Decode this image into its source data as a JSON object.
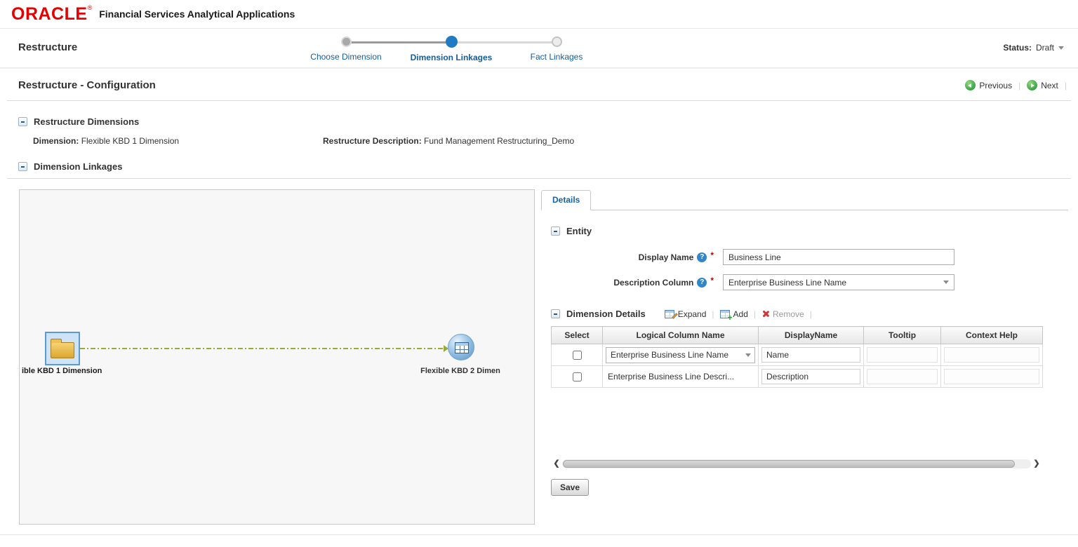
{
  "colors": {
    "brand_red": "#e60000",
    "link_blue": "#155c9c",
    "tab_blue": "#1464a5",
    "step_active_blue": "#1e7bc4",
    "action_green": "#2f9f3f",
    "required_red": "#c00000",
    "connector_olive": "#9aa93c"
  },
  "top_bar": {
    "brand": "ORACLE",
    "brand_mark": "®",
    "app_title": "Financial Services Analytical Applications"
  },
  "workflow_bar": {
    "title": "Restructure",
    "status_label": "Status:",
    "status_value": "Draft",
    "steps": [
      {
        "label": "Choose Dimension",
        "state": "completed"
      },
      {
        "label": "Dimension Linkages",
        "state": "active"
      },
      {
        "label": "Fact Linkages",
        "state": "upcoming"
      }
    ]
  },
  "config_bar": {
    "title": "Restructure - Configuration",
    "previous_label": "Previous",
    "next_label": "Next"
  },
  "restructure_dimensions": {
    "title": "Restructure Dimensions",
    "dimension_label": "Dimension:",
    "dimension_value": "Flexible KBD 1 Dimension",
    "description_label": "Restructure Description:",
    "description_value": "Fund Management Restructuring_Demo"
  },
  "dimension_linkages": {
    "title": "Dimension Linkages",
    "canvas": {
      "source_node_label": "ible KBD 1 Dimension",
      "target_node_label": "Flexible KBD 2 Dimen"
    },
    "details_panel": {
      "tab_label": "Details",
      "entity": {
        "title": "Entity",
        "display_name_label": "Display Name",
        "display_name_value": "Business Line",
        "description_column_label": "Description Column",
        "description_column_value": "Enterprise Business Line Name"
      },
      "dimension_details": {
        "title": "Dimension Details",
        "toolbar": {
          "expand_label": "Expand",
          "add_label": "Add",
          "remove_label": "Remove"
        },
        "table": {
          "columns": [
            "Select",
            "Logical Column Name",
            "DisplayName",
            "Tooltip",
            "Context Help"
          ],
          "rows": [
            {
              "logical_column_name": "Enterprise Business Line Name",
              "display_name": "Name",
              "tooltip": "",
              "context_help": ""
            },
            {
              "logical_column_name": "Enterprise Business Line Descri...",
              "display_name": "Description",
              "tooltip": "",
              "context_help": ""
            }
          ]
        },
        "save_label": "Save"
      }
    }
  }
}
